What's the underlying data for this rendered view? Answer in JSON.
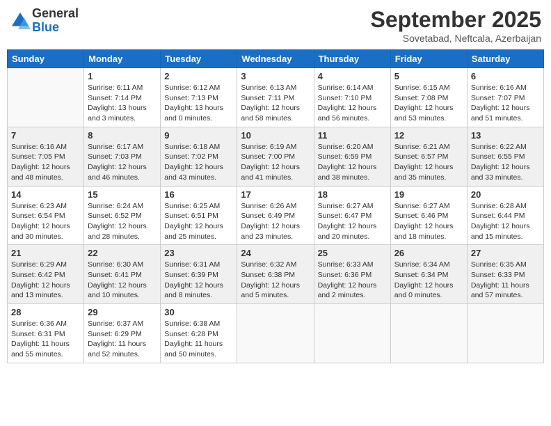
{
  "logo": {
    "general": "General",
    "blue": "Blue"
  },
  "header": {
    "month": "September 2025",
    "location": "Sovetabad, Neftcala, Azerbaijan"
  },
  "days_of_week": [
    "Sunday",
    "Monday",
    "Tuesday",
    "Wednesday",
    "Thursday",
    "Friday",
    "Saturday"
  ],
  "weeks": [
    [
      {
        "day": "",
        "info": ""
      },
      {
        "day": "1",
        "info": "Sunrise: 6:11 AM\nSunset: 7:14 PM\nDaylight: 13 hours\nand 3 minutes."
      },
      {
        "day": "2",
        "info": "Sunrise: 6:12 AM\nSunset: 7:13 PM\nDaylight: 13 hours\nand 0 minutes."
      },
      {
        "day": "3",
        "info": "Sunrise: 6:13 AM\nSunset: 7:11 PM\nDaylight: 12 hours\nand 58 minutes."
      },
      {
        "day": "4",
        "info": "Sunrise: 6:14 AM\nSunset: 7:10 PM\nDaylight: 12 hours\nand 56 minutes."
      },
      {
        "day": "5",
        "info": "Sunrise: 6:15 AM\nSunset: 7:08 PM\nDaylight: 12 hours\nand 53 minutes."
      },
      {
        "day": "6",
        "info": "Sunrise: 6:16 AM\nSunset: 7:07 PM\nDaylight: 12 hours\nand 51 minutes."
      }
    ],
    [
      {
        "day": "7",
        "info": "Sunrise: 6:16 AM\nSunset: 7:05 PM\nDaylight: 12 hours\nand 48 minutes."
      },
      {
        "day": "8",
        "info": "Sunrise: 6:17 AM\nSunset: 7:03 PM\nDaylight: 12 hours\nand 46 minutes."
      },
      {
        "day": "9",
        "info": "Sunrise: 6:18 AM\nSunset: 7:02 PM\nDaylight: 12 hours\nand 43 minutes."
      },
      {
        "day": "10",
        "info": "Sunrise: 6:19 AM\nSunset: 7:00 PM\nDaylight: 12 hours\nand 41 minutes."
      },
      {
        "day": "11",
        "info": "Sunrise: 6:20 AM\nSunset: 6:59 PM\nDaylight: 12 hours\nand 38 minutes."
      },
      {
        "day": "12",
        "info": "Sunrise: 6:21 AM\nSunset: 6:57 PM\nDaylight: 12 hours\nand 35 minutes."
      },
      {
        "day": "13",
        "info": "Sunrise: 6:22 AM\nSunset: 6:55 PM\nDaylight: 12 hours\nand 33 minutes."
      }
    ],
    [
      {
        "day": "14",
        "info": "Sunrise: 6:23 AM\nSunset: 6:54 PM\nDaylight: 12 hours\nand 30 minutes."
      },
      {
        "day": "15",
        "info": "Sunrise: 6:24 AM\nSunset: 6:52 PM\nDaylight: 12 hours\nand 28 minutes."
      },
      {
        "day": "16",
        "info": "Sunrise: 6:25 AM\nSunset: 6:51 PM\nDaylight: 12 hours\nand 25 minutes."
      },
      {
        "day": "17",
        "info": "Sunrise: 6:26 AM\nSunset: 6:49 PM\nDaylight: 12 hours\nand 23 minutes."
      },
      {
        "day": "18",
        "info": "Sunrise: 6:27 AM\nSunset: 6:47 PM\nDaylight: 12 hours\nand 20 minutes."
      },
      {
        "day": "19",
        "info": "Sunrise: 6:27 AM\nSunset: 6:46 PM\nDaylight: 12 hours\nand 18 minutes."
      },
      {
        "day": "20",
        "info": "Sunrise: 6:28 AM\nSunset: 6:44 PM\nDaylight: 12 hours\nand 15 minutes."
      }
    ],
    [
      {
        "day": "21",
        "info": "Sunrise: 6:29 AM\nSunset: 6:42 PM\nDaylight: 12 hours\nand 13 minutes."
      },
      {
        "day": "22",
        "info": "Sunrise: 6:30 AM\nSunset: 6:41 PM\nDaylight: 12 hours\nand 10 minutes."
      },
      {
        "day": "23",
        "info": "Sunrise: 6:31 AM\nSunset: 6:39 PM\nDaylight: 12 hours\nand 8 minutes."
      },
      {
        "day": "24",
        "info": "Sunrise: 6:32 AM\nSunset: 6:38 PM\nDaylight: 12 hours\nand 5 minutes."
      },
      {
        "day": "25",
        "info": "Sunrise: 6:33 AM\nSunset: 6:36 PM\nDaylight: 12 hours\nand 2 minutes."
      },
      {
        "day": "26",
        "info": "Sunrise: 6:34 AM\nSunset: 6:34 PM\nDaylight: 12 hours\nand 0 minutes."
      },
      {
        "day": "27",
        "info": "Sunrise: 6:35 AM\nSunset: 6:33 PM\nDaylight: 11 hours\nand 57 minutes."
      }
    ],
    [
      {
        "day": "28",
        "info": "Sunrise: 6:36 AM\nSunset: 6:31 PM\nDaylight: 11 hours\nand 55 minutes."
      },
      {
        "day": "29",
        "info": "Sunrise: 6:37 AM\nSunset: 6:29 PM\nDaylight: 11 hours\nand 52 minutes."
      },
      {
        "day": "30",
        "info": "Sunrise: 6:38 AM\nSunset: 6:28 PM\nDaylight: 11 hours\nand 50 minutes."
      },
      {
        "day": "",
        "info": ""
      },
      {
        "day": "",
        "info": ""
      },
      {
        "day": "",
        "info": ""
      },
      {
        "day": "",
        "info": ""
      }
    ]
  ]
}
